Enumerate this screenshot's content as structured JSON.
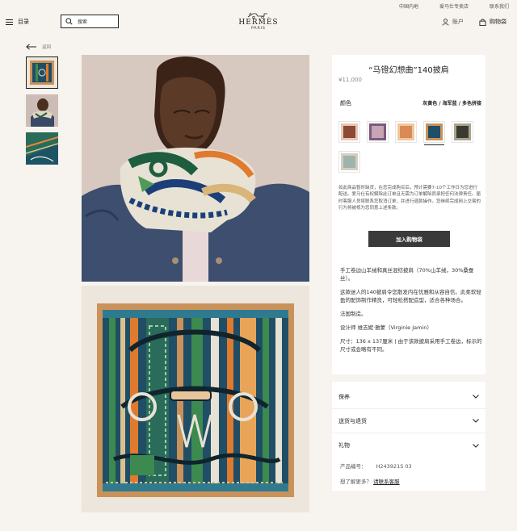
{
  "topbar": {
    "links": [
      "中国内地",
      "爱马仕专卖店",
      "联系我们"
    ]
  },
  "header": {
    "menu_label": "目录",
    "search_placeholder": "搜索",
    "logo": {
      "brand": "HERMÈS",
      "city": "PARIS"
    },
    "account_label": "账户",
    "bag_label": "购物袋"
  },
  "back_label": "返回",
  "thumbnails": [
    {
      "icon": "scarf-flat-thumb",
      "selected": true
    },
    {
      "icon": "model-thumb",
      "selected": false
    },
    {
      "icon": "scarf-folded-thumb",
      "selected": false
    }
  ],
  "product": {
    "title": "“马镫幻想曲”140披肩",
    "price": "¥11,000",
    "color_label": "颜色",
    "color_value": "灰黄色 / 海军蓝 / 多色拼接",
    "swatches": [
      {
        "name": "brown-multicolor",
        "color": "#8a4a34",
        "selected": false
      },
      {
        "name": "pink-multicolor",
        "color": "#c9a3b6",
        "selected": false
      },
      {
        "name": "orange-multicolor",
        "color": "#d98a55",
        "selected": false
      },
      {
        "name": "navy-multicolor",
        "color": "#1f4e66",
        "selected": true
      },
      {
        "name": "black-multicolor",
        "color": "#3a3a33",
        "selected": false
      },
      {
        "name": "grey-multicolor",
        "color": "#9fb3ad",
        "selected": false
      }
    ],
    "order_note": "如此商品暂时缺货，在您完成购买后，预计需要7-10个工作日为您进行配送。爱马仕有权解除此订单且无需为订单解除而承担任何法律责任。届时客服人员将联系您取消订单，并进行退款操作。您继续完成网上交易的行为将被视为您同意上述条款。",
    "add_to_bag": "加入购物袋",
    "description": [
      "手工卷边山羊绒和真丝混纺披肩（70%山羊绒，30%桑蚕丝）。",
      "这款迷人的140披肩令您散发内在优雅和从容自信。此柔软轻盈的配饰制作精良，可轻松搭配造型，适合各种场合。",
      "法国制造。",
      "设计师 维吉妮·雅蒙（Virginie Jamin）",
      "尺寸：136 x 137厘米 | 由于该款披肩采用手工卷边，标示的尺寸或会略有不同。"
    ]
  },
  "accordion": {
    "items": [
      "保养",
      "送货与退货",
      "礼物"
    ],
    "ref_label": "产品编号：",
    "ref_value": "H243921S 03",
    "contact_prefix": "想了解更多？",
    "contact_link": "请联系客服"
  }
}
